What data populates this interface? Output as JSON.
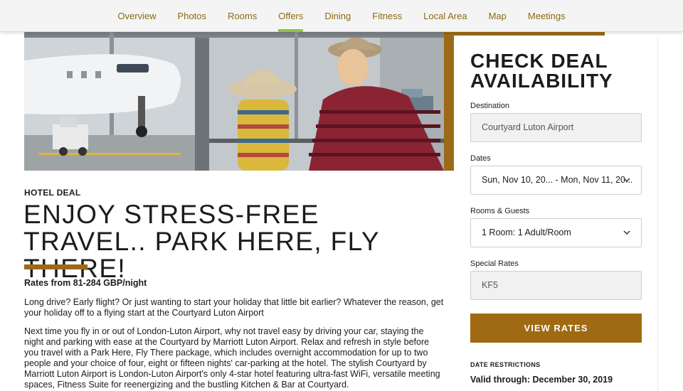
{
  "nav": {
    "items": [
      {
        "label": "Overview"
      },
      {
        "label": "Photos"
      },
      {
        "label": "Rooms"
      },
      {
        "label": "Offers",
        "active": true
      },
      {
        "label": "Dining"
      },
      {
        "label": "Fitness"
      },
      {
        "label": "Local Area"
      },
      {
        "label": "Map"
      },
      {
        "label": "Meetings"
      }
    ]
  },
  "colors": {
    "accent_gold": "#9c6a16",
    "nav_text": "#8a6a12",
    "active_underline": "#8cc63f"
  },
  "deal": {
    "kicker": "HOTEL DEAL",
    "title": "ENJOY STRESS-FREE TRAVEL.. PARK HERE, FLY THERE!",
    "rates": "Rates from 81-284 GBP/night",
    "paragraph1": "Long drive? Early flight? Or just wanting to start your holiday that little bit earlier? Whatever the reason, get your holiday off to a flying start at the Courtyard Luton Airport",
    "paragraph2": "Next time you fly in or out of London-Luton Airport, why not travel easy by driving your car, staying the night and parking with ease at the Courtyard by Marriott Luton Airport. Relax and refresh in style before you travel with a Park Here, Fly There package, which includes overnight accommodation for up to two people and your choice of four, eight or fifteen nights' car-parking at the hotel. The stylish Courtyard by Marriott Luton Airport is London-Luton Airport's only 4-star hotel featuring ultra-fast WiFi, versatile meeting spaces, Fitness Suite for reenergizing and the bustling Kitchen & Bar at Courtyard."
  },
  "booking": {
    "title": "CHECK DEAL AVAILABILITY",
    "destination_label": "Destination",
    "destination_value": "Courtyard Luton Airport",
    "dates_label": "Dates",
    "dates_value": "Sun, Nov 10, 20... - Mon, Nov 11, 20...",
    "rooms_label": "Rooms & Guests",
    "rooms_value": "1 Room: 1 Adult/Room",
    "special_label": "Special Rates",
    "special_value": "KF5",
    "button_label": "VIEW RATES",
    "restrictions_label": "DATE RESTRICTIONS",
    "valid_through": "Valid through: December 30, 2019"
  },
  "icons": {
    "dates_chevron": "chevron-down-icon",
    "rooms_chevron": "chevron-down-icon"
  }
}
